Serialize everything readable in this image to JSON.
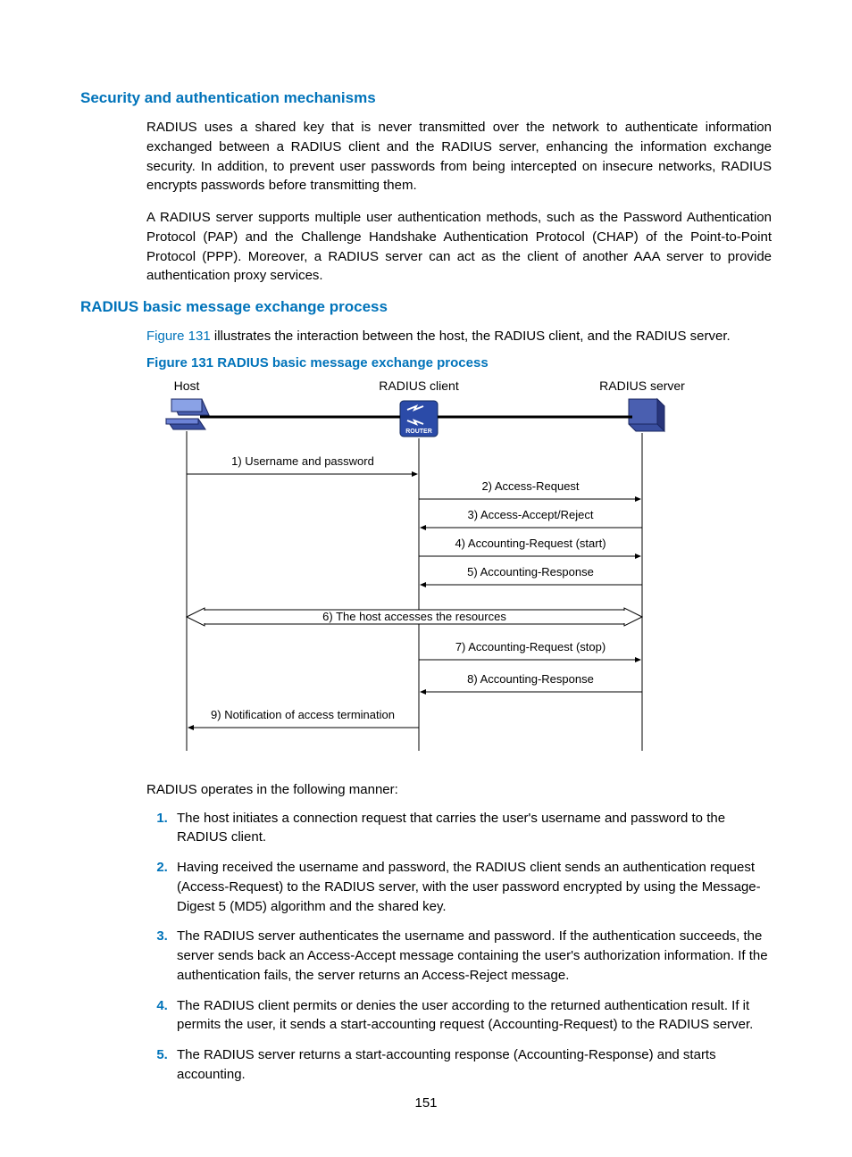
{
  "section1": {
    "heading": "Security and authentication mechanisms",
    "para1": "RADIUS uses a shared key that is never transmitted over the network to authenticate information exchanged between a RADIUS client and the RADIUS server, enhancing the information exchange security. In addition, to prevent user passwords from being intercepted on insecure networks, RADIUS encrypts passwords before transmitting them.",
    "para2": "A RADIUS server supports multiple user authentication methods, such as the Password Authentication Protocol (PAP) and the Challenge Handshake Authentication Protocol (CHAP) of the Point-to-Point Protocol (PPP). Moreover, a RADIUS server can act as the client of another AAA server to provide authentication proxy services."
  },
  "section2": {
    "heading": "RADIUS basic message exchange process",
    "intro_prefix": "Figure 131",
    "intro_rest": " illustrates the interaction between the host, the RADIUS client, and the RADIUS server.",
    "figcaption": "Figure 131 RADIUS basic message exchange process",
    "diagram": {
      "host": "Host",
      "client": "RADIUS client",
      "server": "RADIUS server",
      "router": "ROUTER",
      "steps": {
        "s1": "1) Username and password",
        "s2": "2) Access-Request",
        "s3": "3) Access-Accept/Reject",
        "s4": "4) Accounting-Request (start)",
        "s5": "5) Accounting-Response",
        "s6": "6) The host accesses the resources",
        "s7": "7) Accounting-Request (stop)",
        "s8": "8) Accounting-Response",
        "s9": "9) Notification of access termination"
      }
    },
    "after_fig": "RADIUS operates in the following manner:",
    "list": {
      "i1": "The host initiates a connection request that carries the user's username and password to the RADIUS client.",
      "i2": "Having received the username and password, the RADIUS client sends an authentication request (Access-Request) to the RADIUS server, with the user password encrypted by using the Message-Digest 5 (MD5) algorithm and the shared key.",
      "i3": "The RADIUS server authenticates the username and password. If the authentication succeeds, the server sends back an Access-Accept message containing the user's authorization information. If the authentication fails, the server returns an Access-Reject message.",
      "i4": "The RADIUS client permits or denies the user according to the returned authentication result. If it permits the user, it sends a start-accounting request (Accounting-Request) to the RADIUS server.",
      "i5": "The RADIUS server returns a start-accounting response (Accounting-Response) and starts accounting."
    }
  },
  "pagenum": "151"
}
